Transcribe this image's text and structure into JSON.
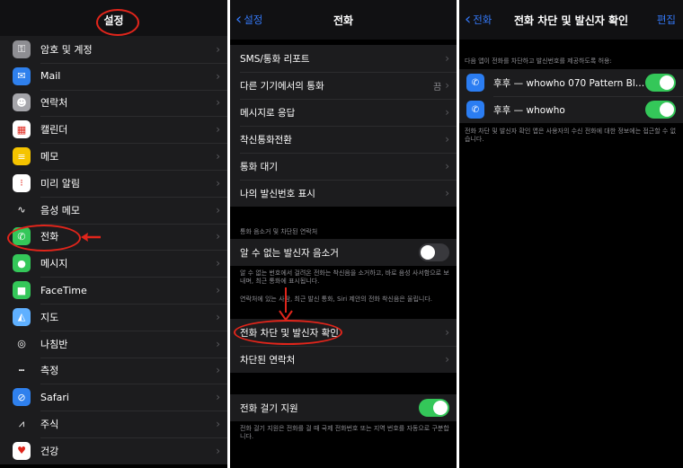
{
  "panel1": {
    "title": "설정",
    "items": [
      {
        "label": "암호 및 계정",
        "icon": "key-icon",
        "color": "#8e8e93",
        "glyph": "⚿"
      },
      {
        "label": "Mail",
        "icon": "mail-icon",
        "color": "#2f80ed",
        "glyph": "✉"
      },
      {
        "label": "연락처",
        "icon": "contacts-icon",
        "color": "#a5a5aa",
        "glyph": "☻"
      },
      {
        "label": "캘린더",
        "icon": "calendar-icon",
        "color": "#ffffff",
        "glyph": "▦"
      },
      {
        "label": "메모",
        "icon": "notes-icon",
        "color": "#f5c400",
        "glyph": "≡"
      },
      {
        "label": "미리 알림",
        "icon": "reminders-icon",
        "color": "#ffffff",
        "glyph": "⁝"
      },
      {
        "label": "음성 메모",
        "icon": "voice-memos-icon",
        "color": "#1c1c1e",
        "glyph": "∿"
      },
      {
        "label": "전화",
        "icon": "phone-icon",
        "color": "#34c759",
        "glyph": "✆"
      },
      {
        "label": "메시지",
        "icon": "messages-icon",
        "color": "#34c759",
        "glyph": "●"
      },
      {
        "label": "FaceTime",
        "icon": "facetime-icon",
        "color": "#34c759",
        "glyph": "■"
      },
      {
        "label": "지도",
        "icon": "maps-icon",
        "color": "#5fb0ff",
        "glyph": "◭"
      },
      {
        "label": "나침반",
        "icon": "compass-icon",
        "color": "#1c1c1e",
        "glyph": "◎"
      },
      {
        "label": "측정",
        "icon": "measure-icon",
        "color": "#1c1c1e",
        "glyph": "┅"
      },
      {
        "label": "Safari",
        "icon": "safari-icon",
        "color": "#2f80ed",
        "glyph": "⊘"
      },
      {
        "label": "주식",
        "icon": "stocks-icon",
        "color": "#1c1c1e",
        "glyph": "⩘"
      },
      {
        "label": "건강",
        "icon": "health-icon",
        "color": "#ffffff",
        "glyph": "♥"
      }
    ]
  },
  "panel2": {
    "back_label": "설정",
    "title": "전화",
    "group1": [
      {
        "label": "SMS/통화 리포트",
        "value": ""
      },
      {
        "label": "다른 기기에서의 통화",
        "value": "끔"
      },
      {
        "label": "메시지로 응답",
        "value": ""
      },
      {
        "label": "착신통화전환",
        "value": ""
      },
      {
        "label": "통화 대기",
        "value": ""
      },
      {
        "label": "나의 발신번호 표시",
        "value": ""
      }
    ],
    "section_header": "통화 음소거 및 차단된 연락처",
    "silence_label": "알 수 없는 발신자 음소거",
    "silence_footnote_1": "알 수 없는 번호에서 걸려온 전화는 착신음을 소거하고, 바로 음성 사서함으로 보내며, 최근 통화에 표시됩니다.",
    "silence_footnote_2": "연락처에 있는 사람, 최근 발신 통화, Siri 제안의 전화 착신음은 울립니다.",
    "group2": [
      {
        "label": "전화 차단 및 발신자 확인"
      },
      {
        "label": "차단된 연락처"
      }
    ],
    "dial_assist_label": "전화 걸기 지원",
    "dial_assist_footnote": "전화 걸기 지원은 전화를 걸 때 국제 전화번호 또는 지역 번호를 자동으로 구분합니다."
  },
  "panel3": {
    "back_label": "전화",
    "title": "전화 차단 및 발신자 확인",
    "edit_label": "편집",
    "header": "다음 앱이 전화를 차단하고 발신번호를 제공하도록 허용:",
    "apps": [
      {
        "label": "후후 — whowho 070 Pattern Blo..."
      },
      {
        "label": "후후 — whowho"
      }
    ],
    "footnote": "전화 차단 및 발신자 확인 앱은 사용자의 수신 전화에 대한 정보에는 접근할 수 없습니다."
  }
}
